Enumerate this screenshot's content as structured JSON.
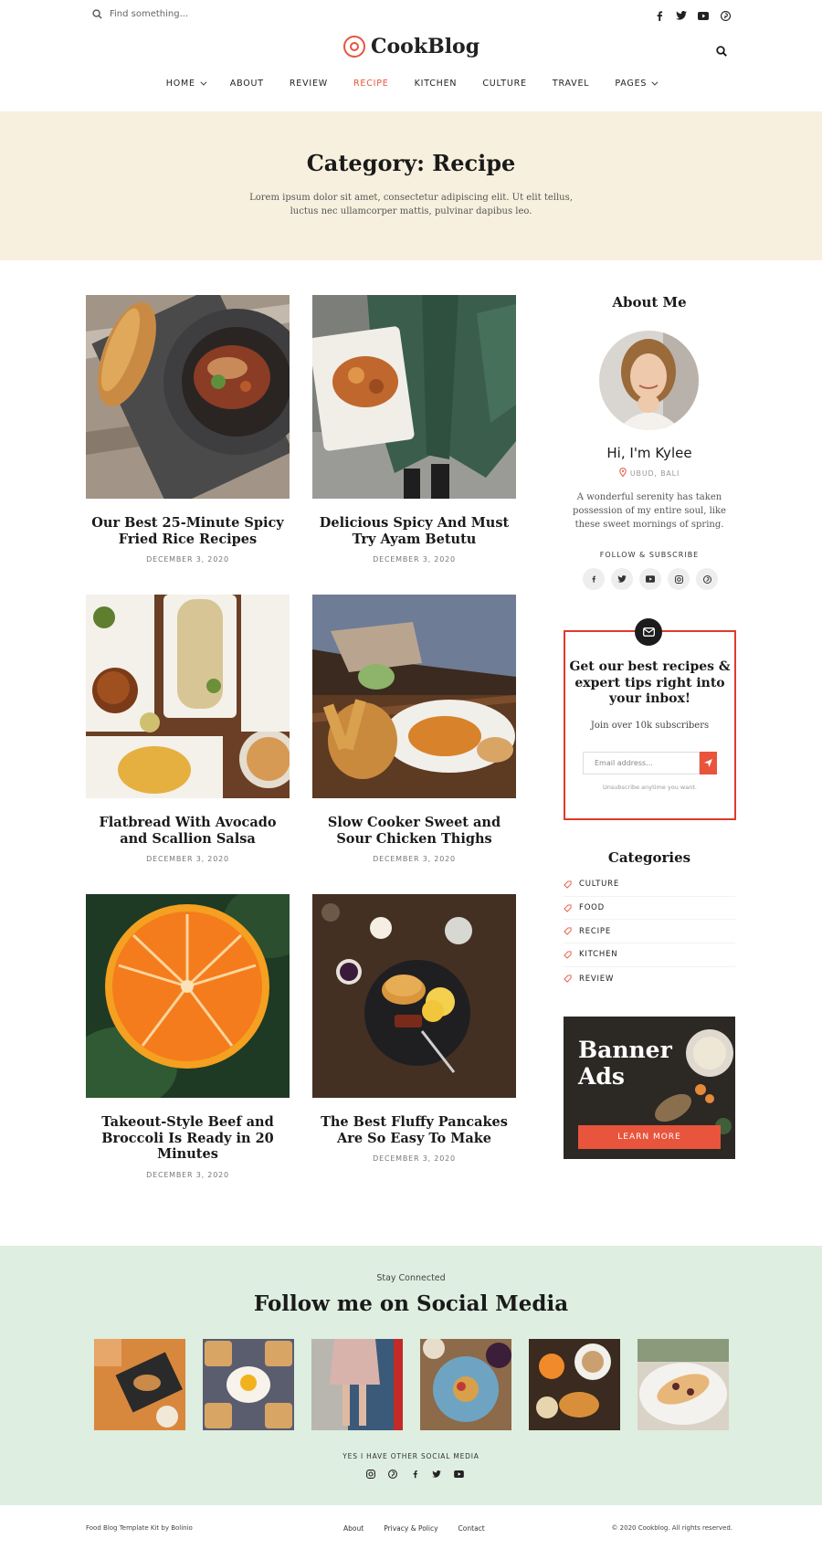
{
  "topbar": {
    "search_placeholder": "Find something...",
    "social": [
      "facebook-icon",
      "twitter-icon",
      "youtube-icon",
      "pinterest-icon"
    ]
  },
  "brand": {
    "name": "CookBlog",
    "accent": "#e8543c"
  },
  "nav": {
    "items": [
      {
        "label": "HOME",
        "dropdown": true
      },
      {
        "label": "ABOUT"
      },
      {
        "label": "REVIEW"
      },
      {
        "label": "RECIPE",
        "active": true
      },
      {
        "label": "KITCHEN"
      },
      {
        "label": "CULTURE"
      },
      {
        "label": "TRAVEL"
      },
      {
        "label": "PAGES",
        "dropdown": true
      }
    ]
  },
  "hero": {
    "title": "Category: Recipe",
    "description": "Lorem ipsum dolor sit amet, consectetur adipiscing elit. Ut elit tellus, luctus nec ullamcorper mattis, pulvinar dapibus leo.",
    "background": "#f8f0de"
  },
  "posts": [
    {
      "title": "Our Best 25-Minute Spicy Fried Rice Recipes",
      "date": "DECEMBER 3, 2020"
    },
    {
      "title": "Delicious Spicy And Must Try Ayam Betutu",
      "date": "DECEMBER 3, 2020"
    },
    {
      "title": "Flatbread With Avocado and Scallion Salsa",
      "date": "DECEMBER 3, 2020"
    },
    {
      "title": "Slow Cooker Sweet and Sour Chicken Thighs",
      "date": "DECEMBER 3, 2020"
    },
    {
      "title": "Takeout-Style Beef and Broccoli Is Ready in 20 Minutes",
      "date": "DECEMBER 3, 2020"
    },
    {
      "title": "The Best Fluffy Pancakes Are So Easy To Make",
      "date": "DECEMBER 3, 2020"
    }
  ],
  "sidebar": {
    "about": {
      "heading": "About Me",
      "greeting": "Hi, I'm Kylee",
      "location": "UBUD, BALI",
      "description": "A wonderful serenity has taken possession of my entire soul, like these sweet mornings of spring.",
      "follow_label": "FOLLOW & SUBSCRIBE",
      "social": [
        "facebook-icon",
        "twitter-icon",
        "youtube-icon",
        "instagram-icon",
        "pinterest-icon"
      ]
    },
    "newsletter": {
      "title": "Get our best recipes & expert tips right into your inbox!",
      "subtitle": "Join over 10k subscribers",
      "email_placeholder": "Email address...",
      "note": "Unsubscribe anytime you want."
    },
    "categories": {
      "heading": "Categories",
      "items": [
        "CULTURE",
        "FOOD",
        "RECIPE",
        "KITCHEN",
        "REVIEW"
      ]
    },
    "banner": {
      "title_line1": "Banner",
      "title_line2": "Ads",
      "button": "LEARN MORE"
    }
  },
  "social_section": {
    "kicker": "Stay Connected",
    "heading": "Follow me on Social Media",
    "other_label": "YES I HAVE OTHER SOCIAL MEDIA",
    "icons": [
      "instagram-icon",
      "pinterest-icon",
      "facebook-icon",
      "twitter-icon",
      "youtube-icon"
    ],
    "background": "#deeee0"
  },
  "footer": {
    "left": "Food Blog Template Kit by Bolinio",
    "links": [
      "About",
      "Privacy & Policy",
      "Contact"
    ],
    "right": "© 2020 Cookblog. All rights reserved."
  }
}
